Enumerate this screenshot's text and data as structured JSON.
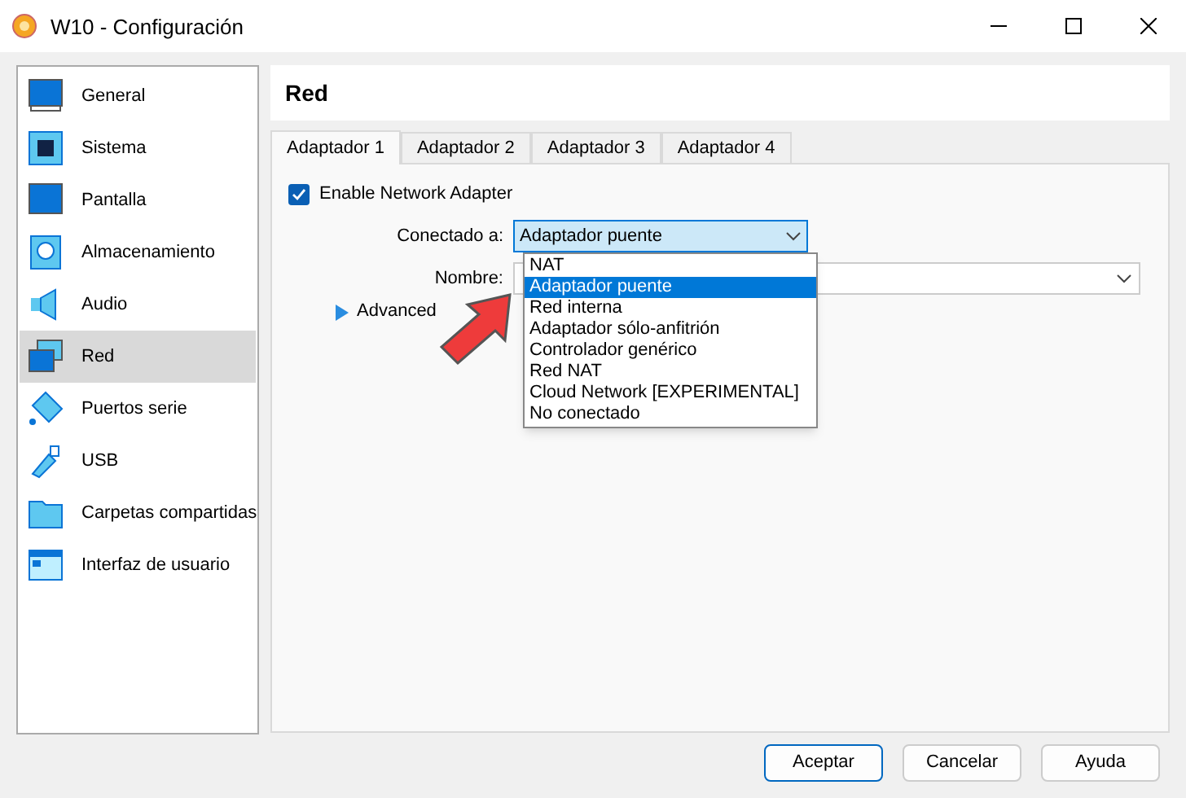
{
  "window": {
    "title": "W10 - Configuración"
  },
  "sidebar": {
    "items": [
      {
        "label": "General",
        "kind": "general",
        "selected": false
      },
      {
        "label": "Sistema",
        "kind": "system",
        "selected": false
      },
      {
        "label": "Pantalla",
        "kind": "display",
        "selected": false
      },
      {
        "label": "Almacenamiento",
        "kind": "storage",
        "selected": false
      },
      {
        "label": "Audio",
        "kind": "audio",
        "selected": false
      },
      {
        "label": "Red",
        "kind": "network",
        "selected": true
      },
      {
        "label": "Puertos serie",
        "kind": "serial",
        "selected": false
      },
      {
        "label": "USB",
        "kind": "usb",
        "selected": false
      },
      {
        "label": "Carpetas compartidas",
        "kind": "folder",
        "selected": false
      },
      {
        "label": "Interfaz de usuario",
        "kind": "ui",
        "selected": false
      }
    ]
  },
  "section_title": "Red",
  "tabs": [
    {
      "label": "Adaptador 1",
      "selected": true
    },
    {
      "label": "Adaptador 2",
      "selected": false
    },
    {
      "label": "Adaptador 3",
      "selected": false
    },
    {
      "label": "Adaptador 4",
      "selected": false
    }
  ],
  "enable_adapter": {
    "label": "Enable Network Adapter",
    "checked": true
  },
  "attached_to": {
    "label": "Conectado a:",
    "value": "Adaptador puente",
    "expanded": true,
    "options": [
      {
        "label": "NAT",
        "selected": false
      },
      {
        "label": "Adaptador puente",
        "selected": true
      },
      {
        "label": "Red interna",
        "selected": false
      },
      {
        "label": "Adaptador sólo-anfitrión",
        "selected": false
      },
      {
        "label": "Controlador genérico",
        "selected": false
      },
      {
        "label": "Red NAT",
        "selected": false
      },
      {
        "label": "Cloud Network [EXPERIMENTAL]",
        "selected": false
      },
      {
        "label": "No conectado",
        "selected": false
      }
    ]
  },
  "name_field": {
    "label": "Nombre:"
  },
  "advanced": {
    "label": "Advanced",
    "expanded": false
  },
  "buttons": [
    {
      "label": "Aceptar",
      "kind": "default"
    },
    {
      "label": "Cancelar",
      "kind": "normal"
    },
    {
      "label": "Ayuda",
      "kind": "normal"
    }
  ]
}
